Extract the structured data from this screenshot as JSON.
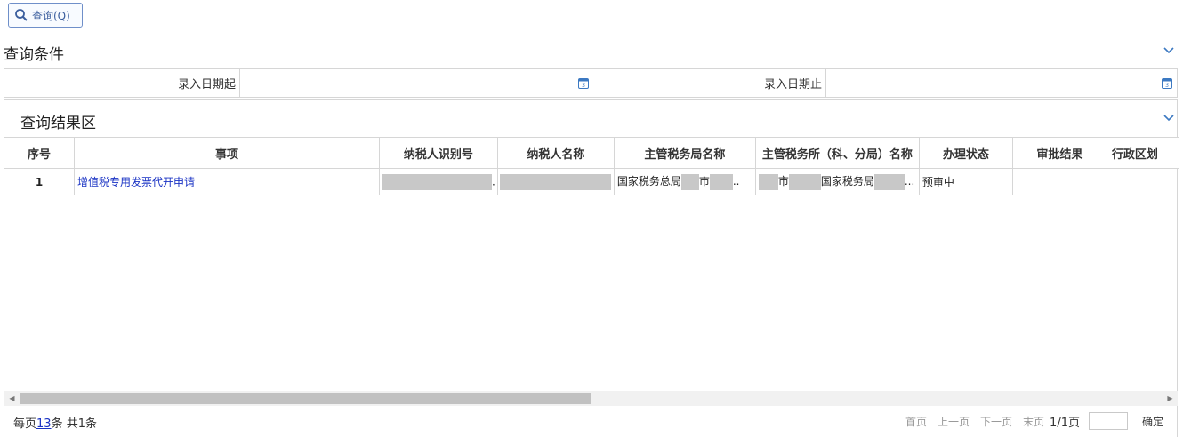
{
  "toolbar": {
    "query_label": "查询(Q)"
  },
  "conditions": {
    "title": "查询条件",
    "start_label": "录入日期起",
    "end_label": "录入日期止",
    "start_value": "",
    "end_value": ""
  },
  "results": {
    "title": "查询结果区",
    "columns": [
      "序号",
      "事项",
      "纳税人识别号",
      "纳税人名称",
      "主管税务局名称",
      "主管税务所（科、分局）名称",
      "办理状态",
      "审批结果",
      "行政区划"
    ],
    "rows": [
      {
        "index": "1",
        "item": "增值税专用发票代开申请",
        "tax_bureau_parts": [
          "国家税务总局",
          "市",
          ".."
        ],
        "tax_office_parts": [
          "市",
          "国家税务局",
          "..."
        ],
        "status": "预审中",
        "approval": "",
        "region": ""
      }
    ]
  },
  "pager": {
    "per_page_prefix": "每页",
    "per_page": "13",
    "per_page_suffix": "条 共1条",
    "first": "首页",
    "prev": "上一页",
    "next": "下一页",
    "last": "末页",
    "page_info": "1/1页",
    "confirm": "确定"
  }
}
